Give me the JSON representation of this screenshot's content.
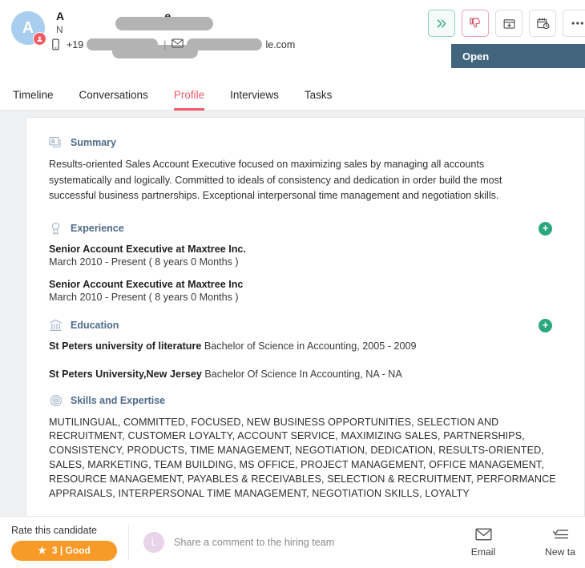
{
  "header": {
    "avatar_initial": "A",
    "avatar_badge_icon": "person-badge-icon",
    "name_visible_prefix": "A",
    "name_visible_suffix": "e",
    "subtitle_prefix": "N",
    "phone_prefix": "+19",
    "email_suffix": "le.com",
    "separator": "|",
    "phone_icon": "mobile-phone-icon",
    "email_icon": "envelope-icon",
    "actions": [
      {
        "name": "advance-stage-button",
        "icon": "double-chevron-right-icon",
        "style": "green"
      },
      {
        "name": "reject-button",
        "icon": "thumbs-down-icon",
        "style": "red"
      },
      {
        "name": "archive-button",
        "icon": "archive-box-icon",
        "style": "plain"
      },
      {
        "name": "schedule-button",
        "icon": "calendar-clock-icon",
        "style": "plain"
      },
      {
        "name": "more-options-button",
        "icon": "ellipsis-icon",
        "style": "plain"
      }
    ],
    "status": {
      "label": "Open",
      "caret": "▾"
    }
  },
  "tabs": [
    {
      "label": "Timeline",
      "active": false
    },
    {
      "label": "Conversations",
      "active": false
    },
    {
      "label": "Profile",
      "active": true
    },
    {
      "label": "Interviews",
      "active": false
    },
    {
      "label": "Tasks",
      "active": false
    }
  ],
  "profile": {
    "summary": {
      "title": "Summary",
      "icon": "profile-card-icon",
      "text": "Results-oriented Sales Account Executive focused on maximizing sales by managing all accounts systematically and logically. Committed to ideals of consistency and dedication in order build the most successful business partnerships. Exceptional interpersonal time management and negotiation skills."
    },
    "experience": {
      "title": "Experience",
      "icon": "award-ribbon-icon",
      "add_label": "+",
      "entries": [
        {
          "title": "Senior Account Executive at Maxtree Inc.",
          "dates": "March 2010 - Present ( 8 years 0 Months )"
        },
        {
          "title": "Senior Account Executive at Maxtree Inc",
          "dates": "March 2010 - Present ( 8 years 0 Months )"
        }
      ]
    },
    "education": {
      "title": "Education",
      "icon": "institution-icon",
      "add_label": "+",
      "entries": [
        {
          "school": "St Peters university of literature",
          "detail": "Bachelor of Science in Accounting, 2005 - 2009"
        },
        {
          "school": "St Peters University,New Jersey",
          "detail": "Bachelor Of Science In Accounting, NA - NA"
        }
      ]
    },
    "skills": {
      "title": "Skills and Expertise",
      "icon": "target-rings-icon",
      "text": "MUTILINGUAL, COMMITTED, FOCUSED, NEW BUSINESS OPPORTUNITIES, SELECTION AND RECRUITMENT, CUSTOMER LOYALTY, ACCOUNT SERVICE, MAXIMIZING SALES, PARTNERSHIPS, CONSISTENCY, PRODUCTS, TIME MANAGEMENT, NEGOTIATION, DEDICATION, RESULTS-ORIENTED, SALES, MARKETING, TEAM BUILDING, MS OFFICE, PROJECT MANAGEMENT, OFFICE MANAGEMENT, RESOURCE MANAGEMENT, PAYABLES & RECEIVABLES, SELECTION & RECRUITMENT, PERFORMANCE APPRAISALS, INTERPERSONAL TIME MANAGEMENT, NEGOTIATION SKILLS, LOYALTY"
    }
  },
  "footer": {
    "rate_label": "Rate this candidate",
    "rating_star": "★",
    "rating_value": "3 | Good",
    "comment_avatar": "L",
    "comment_placeholder": "Share a comment to the hiring team",
    "actions": [
      {
        "label": "Email",
        "icon": "envelope-icon"
      },
      {
        "label": "New ta",
        "icon": "task-list-icon"
      }
    ]
  },
  "colors": {
    "accent_tab": "#ef5b6b",
    "status_bar": "#41657d",
    "add_button": "#2ba77c",
    "rating_pill": "#f89a28",
    "section_title": "#4e6b8a"
  }
}
